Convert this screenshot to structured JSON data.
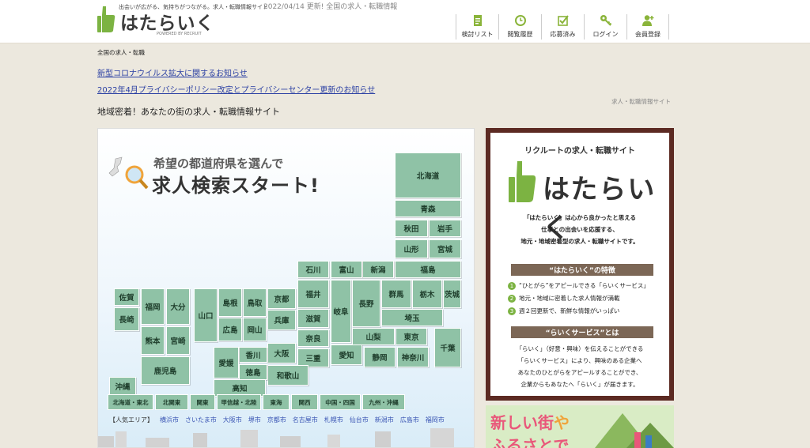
{
  "header": {
    "tagline": "出会いが広がる、気持ちがつながる。求人・転職情報サイト",
    "brand": "はたらいく",
    "powered": "POWERED BY RECRUIT",
    "updated": "2022/04/14 更新! 全国の求人・転職情報",
    "nav": [
      {
        "label": "検討リスト",
        "icon": "document-icon"
      },
      {
        "label": "閲覧履歴",
        "icon": "clock-icon"
      },
      {
        "label": "応募済み",
        "icon": "checkbox-icon"
      },
      {
        "label": "ログイン",
        "icon": "key-icon"
      },
      {
        "label": "会員登録",
        "icon": "user-plus-icon"
      }
    ]
  },
  "breadcrumb": "全国の求人・転職",
  "notices": [
    "新型コロナウイルス拡大に関するお知らせ",
    "2022年4月プライバシーポリシー改定とプライバシーセンター更新のお知らせ"
  ],
  "site_type": "求人・転職情報サイト",
  "headline": "地域密着！あなたの街の求人・転職情報サイト",
  "map": {
    "subtitle": "希望の都道府県を選んで",
    "title": "求人検索スタート!",
    "prefectures": [
      "北海道",
      "青森",
      "秋田",
      "岩手",
      "山形",
      "宮城",
      "福島",
      "新潟",
      "富山",
      "石川",
      "福井",
      "長野",
      "群馬",
      "栃木",
      "茨城",
      "岐阜",
      "埼玉",
      "山梨",
      "東京",
      "千葉",
      "滋賀",
      "京都",
      "兵庫",
      "奈良",
      "三重",
      "愛知",
      "静岡",
      "神奈川",
      "大阪",
      "和歌山",
      "鳥取",
      "島根",
      "岡山",
      "広島",
      "山口",
      "香川",
      "愛媛",
      "徳島",
      "高知",
      "福岡",
      "佐賀",
      "長崎",
      "大分",
      "熊本",
      "宮崎",
      "鹿児島",
      "沖縄"
    ],
    "regions": [
      "北海道・東北",
      "北関東",
      "関東",
      "甲信越・北陸",
      "東海",
      "関西",
      "中国・四国",
      "九州・沖縄"
    ],
    "popular_label": "【人気エリア】",
    "popular_cities": [
      "横浜市",
      "さいたま市",
      "大阪市",
      "堺市",
      "京都市",
      "名古屋市",
      "札幌市",
      "仙台市",
      "新潟市",
      "広島市",
      "福岡市"
    ]
  },
  "promo": {
    "head": "リクルートの求人・転職サイト",
    "brand": "はたらいく",
    "desc": [
      "「はたらいく」は心から良かったと思える",
      "仕事との出会いを応援する、",
      "地元・地域密着型の求人・転職サイトです。"
    ],
    "features_title": "“はたらいく”の特徴",
    "features": [
      "“ひとがら”をアピールできる「らいくサービス」",
      "地元・地域に密着した求人情報が満載",
      "週２回更新で、新鮮な情報がいっぱい"
    ],
    "service_title": "“らいくサービス”とは",
    "service_desc": [
      "「らいく」（好意・興味）を伝えることができる",
      "「らいくサービス」により、興味のある企業へ",
      "あなたのひとがらをアピールすることができ、",
      "企業からもあなたへ「らいく」が届きます。"
    ]
  },
  "banner": {
    "text1": "新しい街",
    "text2": "や",
    "text3": "ふるさとで"
  },
  "colors": {
    "pref_green": "#8fc2a6",
    "link_blue": "#2a3fa3",
    "promo_border": "#5c2a22",
    "brand_green": "#7cb342"
  }
}
